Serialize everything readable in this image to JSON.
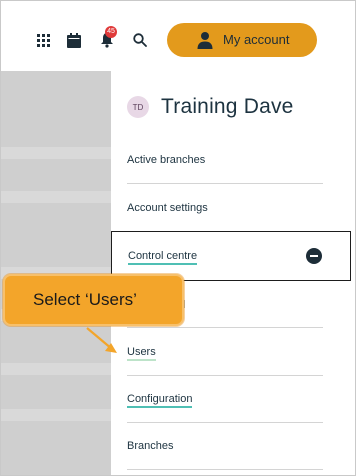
{
  "topbar": {
    "notification_count": "45",
    "account_button_label": "My account"
  },
  "icons": {
    "apps": "grid-icon",
    "calendar": "calendar-icon",
    "notifications": "bell-icon",
    "search": "search-icon",
    "account": "person-icon",
    "collapse": "minus-circle-icon"
  },
  "profile": {
    "initials": "TD",
    "name": "Training Dave"
  },
  "menu": {
    "active_branches": "Active branches",
    "account_settings": "Account settings",
    "control_centre": "Control centre",
    "dashboard_partial": "board",
    "users": "Users",
    "configuration": "Configuration",
    "branches": "Branches"
  },
  "callout": {
    "text": "Select ‘Users’"
  },
  "colors": {
    "accent_orange": "#e39a1c",
    "callout_orange": "#f3a52a",
    "underline_teal": "#4fbfb4",
    "badge_red": "#e03a3a",
    "text_dark": "#1d3340"
  }
}
